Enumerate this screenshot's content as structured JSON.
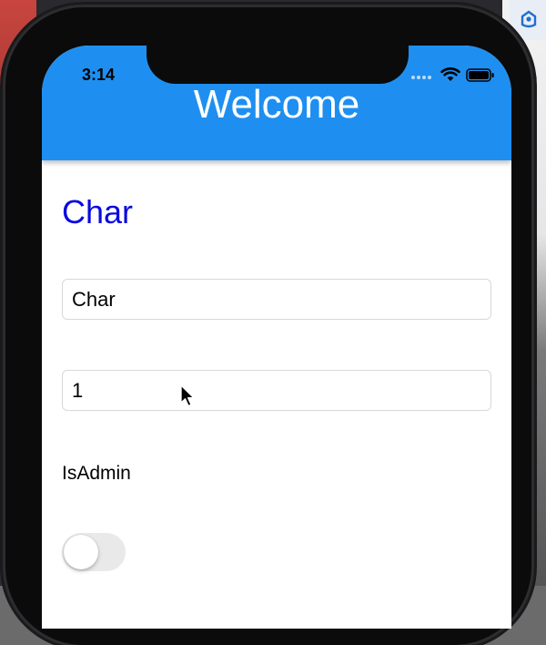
{
  "status_bar": {
    "time": "3:14"
  },
  "header": {
    "title": "Welcome"
  },
  "page": {
    "heading": "Char"
  },
  "form": {
    "name_value": "Char",
    "number_value": "1",
    "is_admin_label": "IsAdmin",
    "is_admin_on": false
  },
  "icons": [
    "wifi-icon",
    "battery-icon",
    "signal-icon",
    "mouse-pointer-icon",
    "app-icon"
  ],
  "colors": {
    "header": "#1e8ff0",
    "heading": "#0a0adf",
    "toggle_off": "#e9e9ea"
  }
}
